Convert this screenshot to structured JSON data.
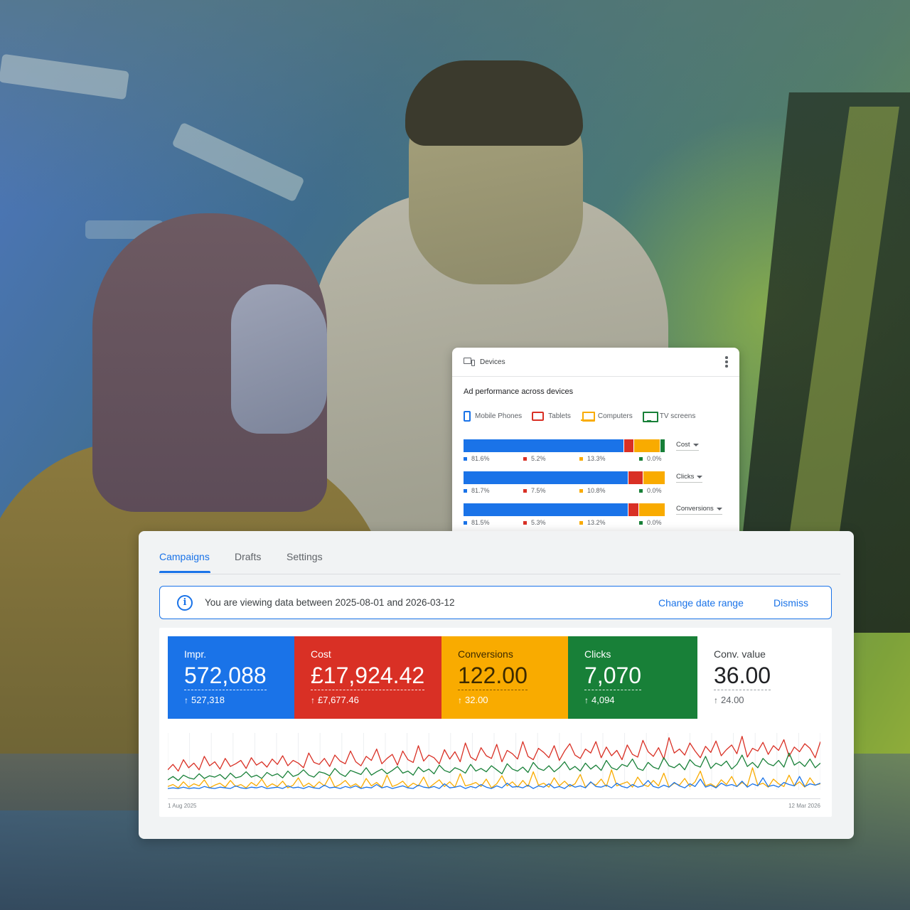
{
  "devices": {
    "title": "Devices",
    "subtitle": "Ad performance across devices",
    "legend": [
      {
        "name": "Mobile Phones",
        "icon": "mobile-phone-icon",
        "color": "#1a73e8"
      },
      {
        "name": "Tablets",
        "icon": "tablet-icon",
        "color": "#d93025"
      },
      {
        "name": "Computers",
        "icon": "computer-icon",
        "color": "#f9ab00"
      },
      {
        "name": "TV screens",
        "icon": "tv-screen-icon",
        "color": "#188038"
      }
    ],
    "rows": [
      {
        "metric": "Cost",
        "values": [
          81.6,
          5.2,
          13.3,
          0.0
        ],
        "labels": [
          "81.6%",
          "5.2%",
          "13.3%",
          "0.0%"
        ],
        "bar_values": [
          81.6,
          5.2,
          13.3,
          2.5
        ]
      },
      {
        "metric": "Clicks",
        "values": [
          81.7,
          7.5,
          10.8,
          0.0
        ],
        "labels": [
          "81.7%",
          "7.5%",
          "10.8%",
          "0.0%"
        ],
        "bar_values": [
          81.7,
          7.5,
          10.8,
          0
        ]
      },
      {
        "metric": "Conversions",
        "values": [
          81.5,
          5.3,
          13.2,
          0.0
        ],
        "labels": [
          "81.5%",
          "5.3%",
          "13.2%",
          "0.0%"
        ],
        "bar_values": [
          81.5,
          5.3,
          13.2,
          0
        ]
      }
    ]
  },
  "tabs": [
    {
      "label": "Campaigns",
      "active": true
    },
    {
      "label": "Drafts",
      "active": false
    },
    {
      "label": "Settings",
      "active": false
    }
  ],
  "banner": {
    "text": "You are viewing data between 2025-08-01 and 2026-03-12",
    "change_label": "Change date range",
    "dismiss_label": "Dismiss"
  },
  "metrics": [
    {
      "label": "Impr.",
      "value": "572,088",
      "delta": "527,318",
      "color": "#1a73e8"
    },
    {
      "label": "Cost",
      "value": "£17,924.42",
      "delta": "£7,677.46",
      "color": "#d93025"
    },
    {
      "label": "Conversions",
      "value": "122.00",
      "delta": "32.00",
      "color": "#f9ab00"
    },
    {
      "label": "Clicks",
      "value": "7,070",
      "delta": "4,094",
      "color": "#188038"
    },
    {
      "label": "Conv. value",
      "value": "36.00",
      "delta": "24.00",
      "color": "#ffffff"
    }
  ],
  "chart_data": {
    "type": "line",
    "x_start_label": "1 Aug 2025",
    "x_end_label": "12 Mar 2026",
    "grid": true,
    "series": [
      {
        "color": "#d93025",
        "values": [
          30,
          38,
          28,
          45,
          33,
          40,
          30,
          50,
          36,
          42,
          31,
          47,
          35,
          39,
          44,
          32,
          48,
          37,
          42,
          34,
          46,
          38,
          51,
          36,
          44,
          40,
          33,
          55,
          41,
          38,
          47,
          35,
          52,
          43,
          39,
          58,
          42,
          36,
          50,
          44,
          61,
          39,
          47,
          53,
          37,
          58,
          45,
          41,
          66,
          43,
          52,
          48,
          39,
          60,
          46,
          57,
          42,
          70,
          49,
          44,
          63,
          51,
          47,
          68,
          42,
          59,
          54,
          46,
          72,
          50,
          45,
          62,
          56,
          48,
          66,
          44,
          58,
          69,
          52,
          47,
          61,
          55,
          72,
          48,
          64,
          51,
          59,
          45,
          67,
          53,
          49,
          74,
          57,
          50,
          63,
          46,
          78,
          55,
          61,
          52,
          70,
          58,
          48,
          65,
          56,
          73,
          51,
          60,
          67,
          54,
          80,
          49,
          62,
          58,
          71,
          53,
          66,
          59,
          75,
          50,
          64,
          57,
          69,
          62,
          48,
          72
        ]
      },
      {
        "color": "#188038",
        "values": [
          15,
          20,
          14,
          22,
          18,
          16,
          24,
          17,
          21,
          19,
          23,
          16,
          25,
          18,
          20,
          27,
          19,
          22,
          17,
          26,
          21,
          24,
          18,
          28,
          20,
          23,
          30,
          22,
          19,
          27,
          25,
          21,
          32,
          24,
          20,
          29,
          26,
          23,
          33,
          22,
          27,
          31,
          24,
          29,
          35,
          25,
          28,
          22,
          34,
          27,
          31,
          24,
          37,
          29,
          26,
          33,
          30,
          25,
          38,
          28,
          32,
          27,
          36,
          30,
          24,
          39,
          31,
          28,
          34,
          26,
          41,
          32,
          29,
          36,
          27,
          33,
          42,
          30,
          35,
          28,
          40,
          31,
          37,
          29,
          44,
          33,
          30,
          38,
          35,
          46,
          32,
          29,
          41,
          34,
          31,
          48,
          36,
          33,
          39,
          30,
          45,
          37,
          34,
          50,
          32,
          40,
          36,
          43,
          31,
          38,
          52,
          35,
          41,
          33,
          47,
          39,
          36,
          44,
          34,
          55,
          37,
          42,
          35,
          46,
          33,
          40
        ]
      },
      {
        "color": "#f9ab00",
        "values": [
          5,
          8,
          3,
          12,
          4,
          9,
          6,
          15,
          3,
          7,
          10,
          4,
          14,
          5,
          8,
          3,
          11,
          6,
          16,
          4,
          9,
          5,
          13,
          3,
          7,
          18,
          5,
          10,
          4,
          12,
          6,
          20,
          4,
          8,
          14,
          5,
          9,
          3,
          17,
          6,
          11,
          4,
          22,
          5,
          8,
          13,
          4,
          10,
          6,
          19,
          3,
          9,
          15,
          5,
          12,
          4,
          24,
          6,
          8,
          11,
          5,
          16,
          3,
          9,
          21,
          6,
          12,
          4,
          14,
          5,
          27,
          7,
          10,
          4,
          18,
          6,
          13,
          5,
          9,
          23,
          4,
          11,
          7,
          16,
          5,
          30,
          6,
          9,
          12,
          4,
          19,
          8,
          5,
          14,
          6,
          25,
          4,
          10,
          7,
          17,
          5,
          12,
          28,
          6,
          9,
          4,
          15,
          8,
          20,
          5,
          11,
          6,
          33,
          7,
          10,
          4,
          16,
          9,
          5,
          22,
          6,
          12,
          4,
          18,
          7,
          9
        ]
      },
      {
        "color": "#1a73e8",
        "values": [
          2,
          3,
          2,
          4,
          2,
          3,
          2,
          5,
          3,
          2,
          4,
          3,
          2,
          6,
          3,
          2,
          4,
          3,
          5,
          2,
          3,
          4,
          2,
          6,
          3,
          4,
          2,
          5,
          3,
          2,
          7,
          3,
          4,
          2,
          5,
          3,
          6,
          2,
          4,
          3,
          8,
          3,
          5,
          2,
          4,
          6,
          3,
          2,
          7,
          4,
          3,
          5,
          2,
          9,
          3,
          4,
          6,
          2,
          5,
          3,
          8,
          4,
          2,
          6,
          3,
          10,
          4,
          5,
          3,
          7,
          2,
          6,
          4,
          9,
          3,
          5,
          2,
          8,
          4,
          6,
          3,
          12,
          5,
          4,
          7,
          3,
          10,
          5,
          3,
          8,
          4,
          6,
          14,
          5,
          3,
          7,
          4,
          11,
          6,
          3,
          9,
          5,
          16,
          4,
          7,
          3,
          10,
          6,
          8,
          5,
          13,
          4,
          9,
          6,
          18,
          5,
          7,
          4,
          11,
          8,
          6,
          20,
          5,
          9,
          7,
          10
        ]
      }
    ]
  }
}
